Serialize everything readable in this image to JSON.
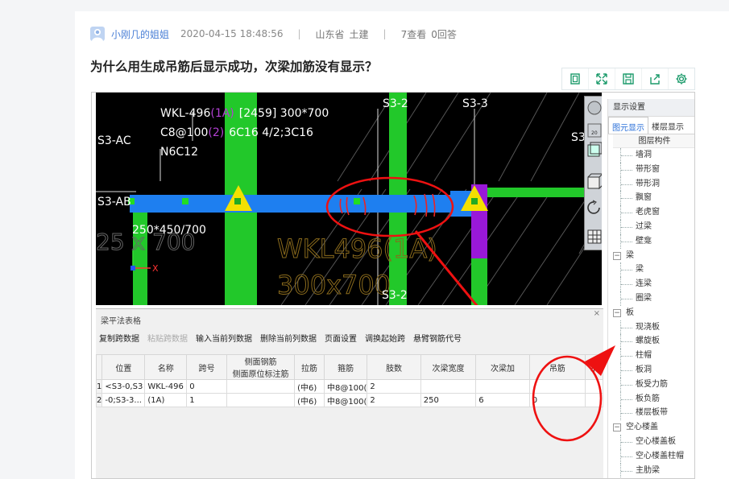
{
  "meta": {
    "author": "小刚几的姐姐",
    "date": "2020-04-15 18:48:56",
    "separator": "|",
    "province": "山东省",
    "category": "土建",
    "views": "7查看",
    "answers": "0回答"
  },
  "question_title": "为什么用生成吊筋后显示成功，次梁加筋没有显示？",
  "cad": {
    "beam_line1_a": "WKL-496",
    "beam_line1_b": "(1A)",
    "beam_line1_c": "[2459] 300*700",
    "beam_line2_a": "C8@100",
    "beam_line2_b": "(2)",
    "beam_line2_c": "6C16 4/2;3C16",
    "beam_line3": "N6C12",
    "axis_s3ac": "S3-AC",
    "axis_s3ab": "S3-AB",
    "axis_s32_top": "S3-2",
    "axis_s33": "S3-3",
    "axis_s32_bottom": "S3-2",
    "axis_s3_right": "S3",
    "dim_label": "250*450/700",
    "big_text1": "WKL496(1A)",
    "big_text2": "300x700",
    "axis_x": "X"
  },
  "side_panel": {
    "header": "显示设置",
    "tab_active": "图元显示",
    "tab_other": "楼层显示",
    "subheader": "图层构件",
    "items": [
      {
        "label": "墙洞",
        "type": "leaf"
      },
      {
        "label": "带形窗",
        "type": "leaf"
      },
      {
        "label": "带形洞",
        "type": "leaf"
      },
      {
        "label": "飘窗",
        "type": "leaf"
      },
      {
        "label": "老虎窗",
        "type": "leaf"
      },
      {
        "label": "过梁",
        "type": "leaf"
      },
      {
        "label": "壁龛",
        "type": "leaf"
      },
      {
        "label": "梁",
        "type": "group"
      },
      {
        "label": "梁",
        "type": "leaf"
      },
      {
        "label": "连梁",
        "type": "leaf"
      },
      {
        "label": "圈梁",
        "type": "leaf"
      },
      {
        "label": "板",
        "type": "group"
      },
      {
        "label": "现浇板",
        "type": "leaf"
      },
      {
        "label": "螺旋板",
        "type": "leaf"
      },
      {
        "label": "柱帽",
        "type": "leaf"
      },
      {
        "label": "板洞",
        "type": "leaf"
      },
      {
        "label": "板受力筋",
        "type": "leaf"
      },
      {
        "label": "板负筋",
        "type": "leaf"
      },
      {
        "label": "楼层板带",
        "type": "leaf"
      },
      {
        "label": "空心楼盖",
        "type": "group"
      },
      {
        "label": "空心楼盖板",
        "type": "leaf"
      },
      {
        "label": "空心楼盖柱帽",
        "type": "leaf"
      },
      {
        "label": "主肋梁",
        "type": "leaf"
      }
    ]
  },
  "table_panel": {
    "title": "梁平法表格",
    "close": "×",
    "actions": [
      {
        "label": "复制跨数据",
        "disabled": false
      },
      {
        "label": "粘贴跨数据",
        "disabled": true
      },
      {
        "label": "输入当前列数据",
        "disabled": false
      },
      {
        "label": "删除当前列数据",
        "disabled": false
      },
      {
        "label": "页面设置",
        "disabled": false
      },
      {
        "label": "调换起始跨",
        "disabled": false
      },
      {
        "label": "悬臂钢筋代号",
        "disabled": false
      }
    ],
    "headers": {
      "pos": "位置",
      "name": "名称",
      "span": "跨号",
      "side_top": "侧面钢筋",
      "side_bottom": "侧面原位标注筋",
      "tie": "拉筋",
      "stirrup": "箍筋",
      "legs": "肢数",
      "sec_width": "次梁宽度",
      "sec_add": "次梁加",
      "hanger": "吊筋",
      "hanger2": "吊"
    },
    "rows": [
      {
        "num": "1",
        "pos": "<S3-0,S3",
        "name": "WKL-496",
        "span": "0",
        "side": "",
        "tie": "(中6)",
        "stirrup": "中8@100(",
        "legs": "2",
        "sec_width": "",
        "sec_add": "",
        "hanger": "",
        "hanger2": ""
      },
      {
        "num": "2",
        "pos": "-0;S3-3...",
        "name": "(1A)",
        "span": "1",
        "side": "",
        "tie": "(中6)",
        "stirrup": "中8@100(",
        "legs": "2",
        "sec_width": "250",
        "sec_add": "6",
        "hanger": "0",
        "hanger2": ""
      }
    ]
  }
}
